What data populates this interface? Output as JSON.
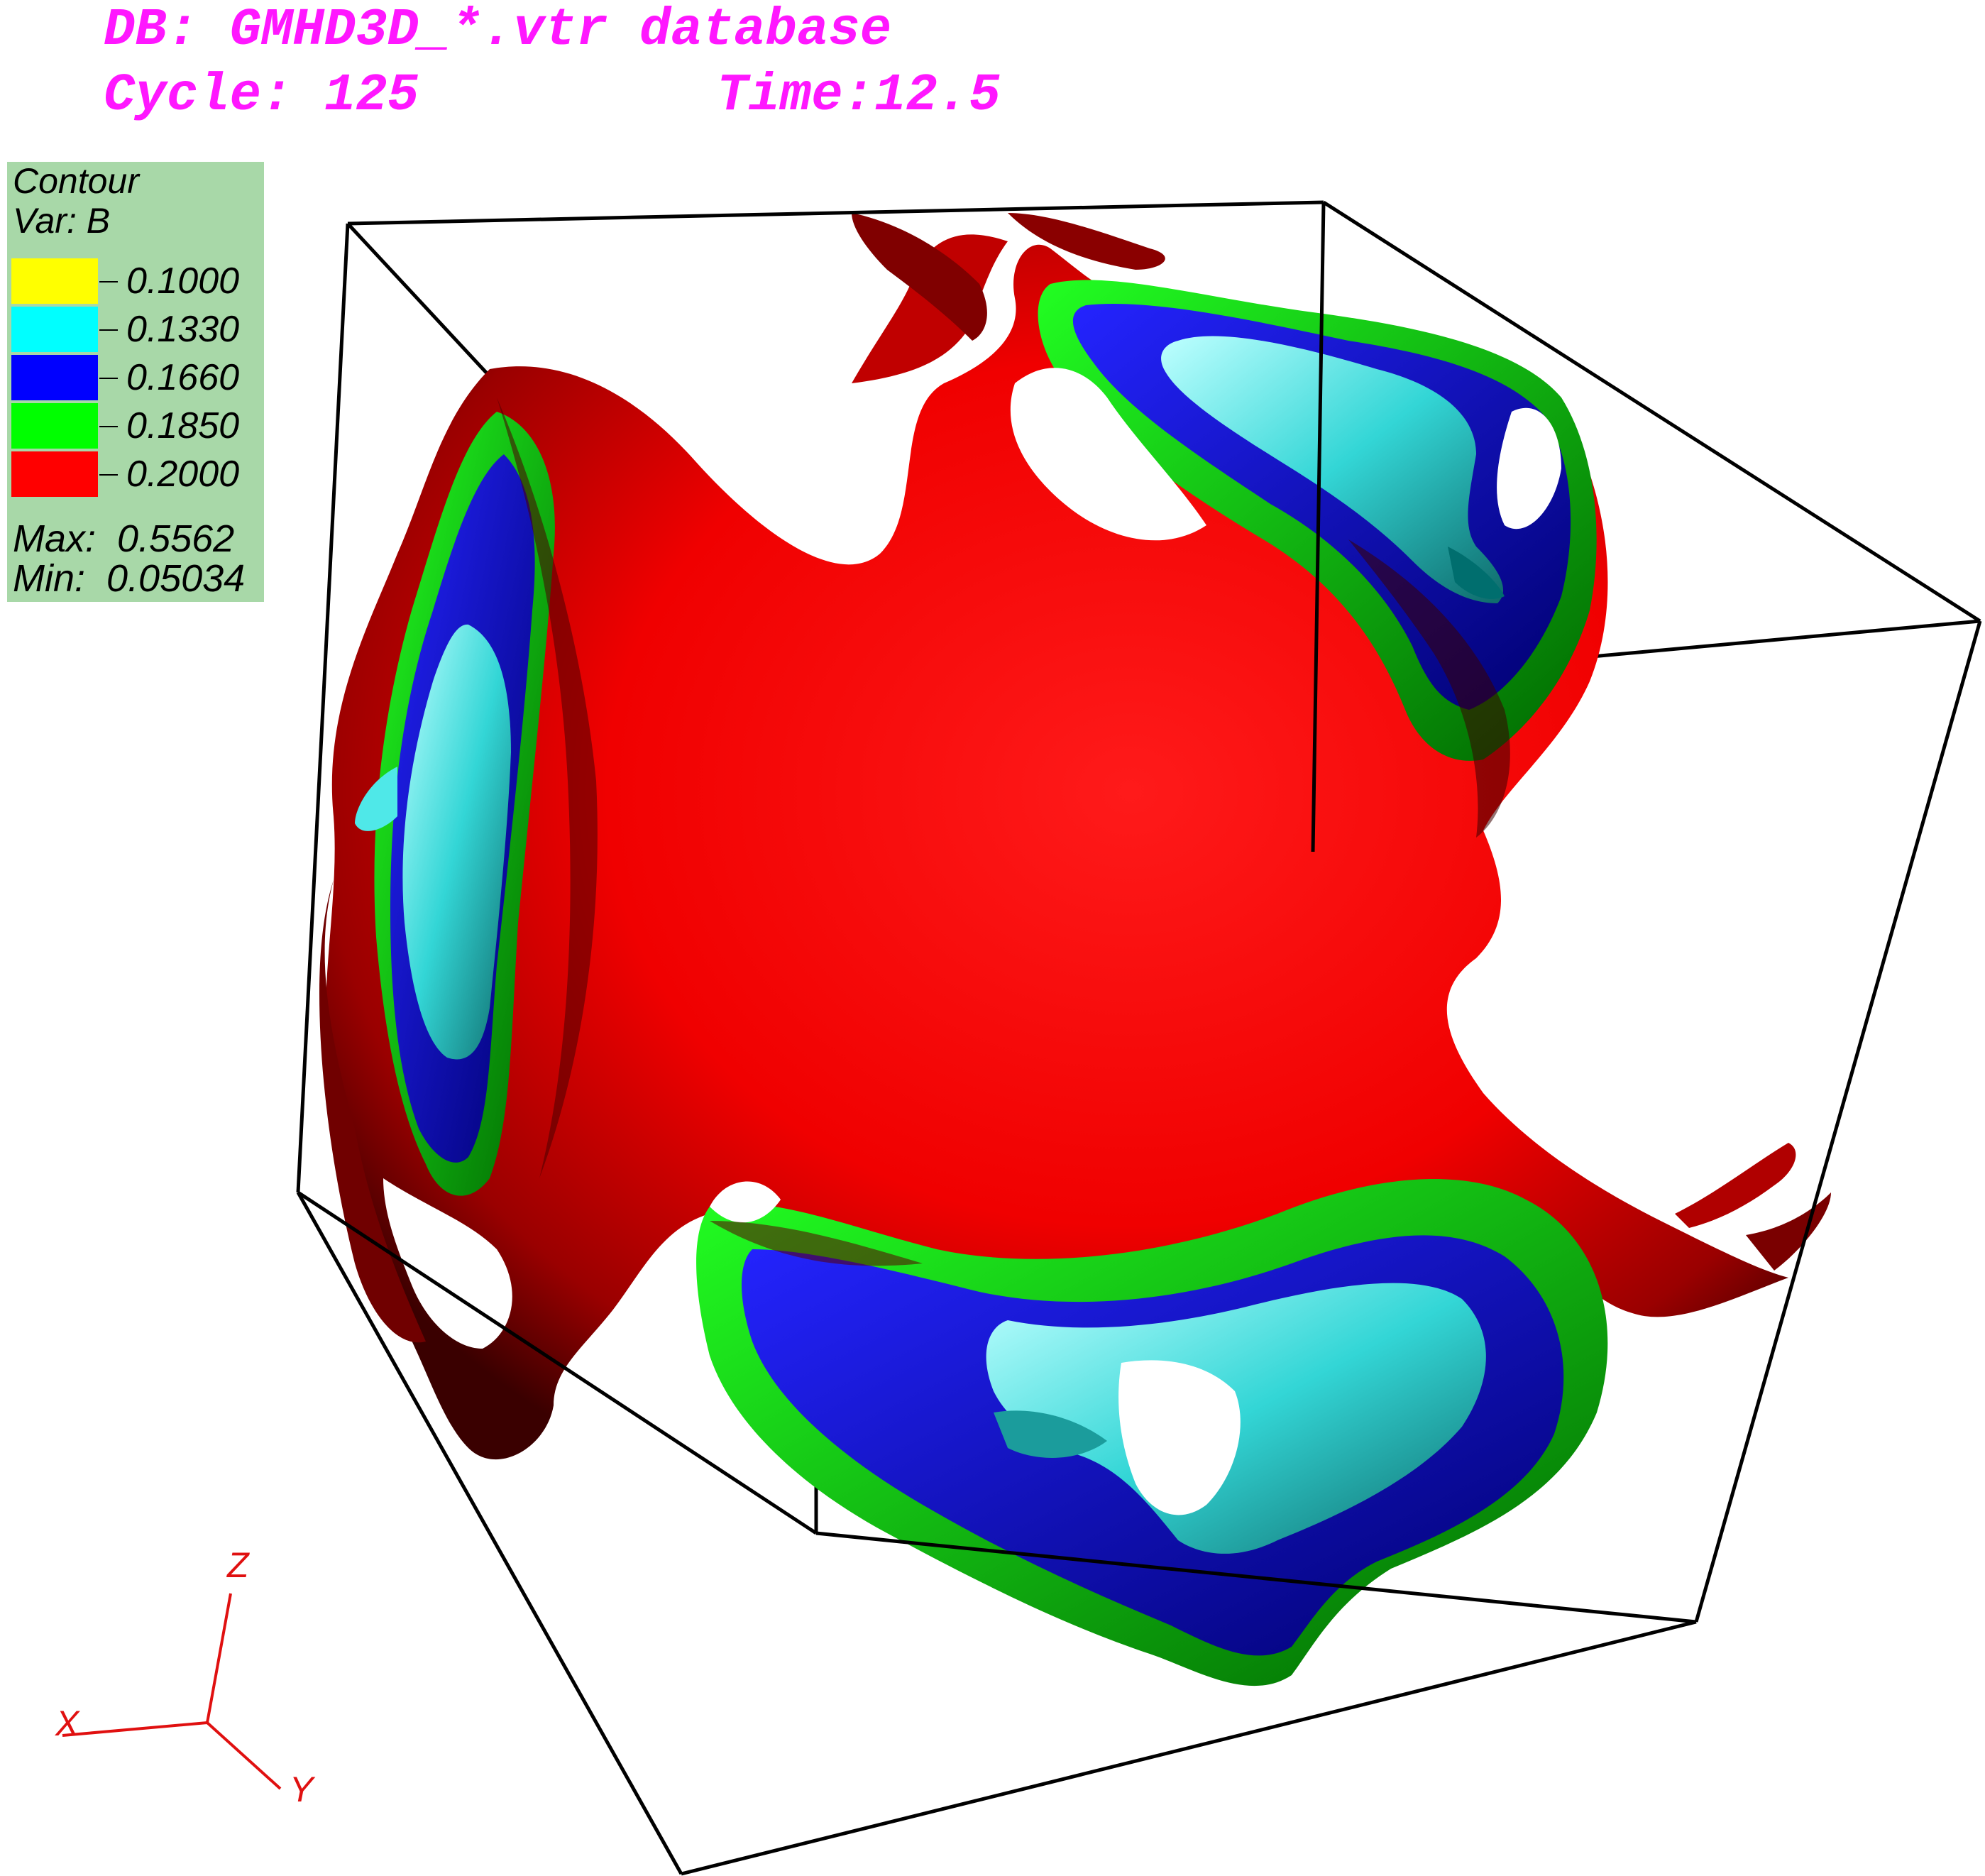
{
  "header": {
    "db_line": "DB: GMHD3D_*.vtr database",
    "cycle_label": "Cycle: 125",
    "time_label": "Time:12.5"
  },
  "legend": {
    "title": "Contour",
    "var": "Var: B",
    "levels": [
      {
        "value": "0.1000",
        "color": "#ffff00"
      },
      {
        "value": "0.1330",
        "color": "#00ffff"
      },
      {
        "value": "0.1660",
        "color": "#0000ff"
      },
      {
        "value": "0.1850",
        "color": "#00ff00"
      },
      {
        "value": "0.2000",
        "color": "#ff0000"
      }
    ],
    "max": "Max:  0.5562",
    "min": "Min:  0.05034"
  },
  "triad": {
    "x": "X",
    "y": "Y",
    "z": "Z"
  },
  "colors": {
    "header": "#ff17ff",
    "legend_bg": "#a8d8a8",
    "triad": "#e01010"
  }
}
